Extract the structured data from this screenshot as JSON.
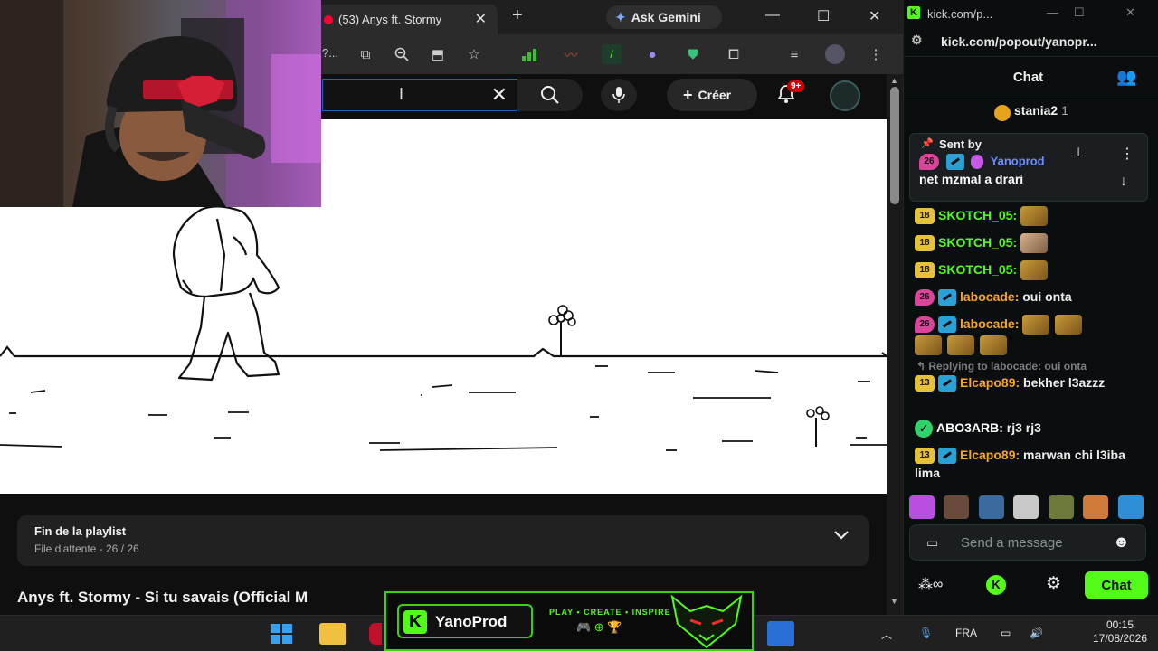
{
  "browser": {
    "tab_title": "(53) Anys ft. Stormy",
    "tab_close": "✕",
    "new_tab": "+",
    "gemini_label": "Ask Gemini",
    "toolbar_trunc": "?...",
    "window_controls": [
      "—",
      "☐",
      "✕"
    ]
  },
  "youtube": {
    "create_label": "Créer",
    "notification_badge": "9+",
    "playlist": {
      "title": "Fin de la playlist",
      "subtitle": "File d'attente - 26 / 26"
    },
    "video_title": "Anys ft. Stormy - Si tu savais (Official M"
  },
  "kick": {
    "window_title": "kick.com/p...",
    "address": "kick.com/popout/yanopr...",
    "header_label": "Chat",
    "top_gifter": {
      "name": "stania2",
      "count": "1"
    },
    "pinned": {
      "sent_by_label": "Sent by",
      "badge": "26",
      "user": "Yanoprod",
      "text": "net mzmal a drari"
    },
    "messages": [
      {
        "badge": "18",
        "user": "SKOTCH_05:",
        "text": ""
      },
      {
        "badge": "18",
        "user": "SKOTCH_05:",
        "text": ""
      },
      {
        "badge": "18",
        "user": "SKOTCH_05:",
        "text": ""
      },
      {
        "badge": "26",
        "user": "labocade:",
        "text": "oui onta"
      },
      {
        "badge": "26",
        "user": "labocade:",
        "text": ""
      },
      {
        "badge": "13",
        "user": "Elcapo89:",
        "text": "bekher l3azzz"
      },
      {
        "badge": "",
        "user": "ABO3ARB:",
        "text": "rj3 rj3"
      },
      {
        "badge": "13",
        "user": "Elcapo89:",
        "text": "marwan chi l3iba lima"
      }
    ],
    "reply_label": "Replying to labocade: oui onta",
    "input_placeholder": "Send a message",
    "chat_button": "Chat",
    "colors": {
      "accent": "#53fc18",
      "gold": "#e6c23a",
      "pink": "#d9459a",
      "orange": "#f5a623"
    }
  },
  "banner": {
    "name": "YanoProd",
    "slogan": "PLAY • CREATE • INSPIRE"
  },
  "taskbar": {
    "language": "FRA",
    "time": "00:15",
    "date": "17/08/2026"
  }
}
